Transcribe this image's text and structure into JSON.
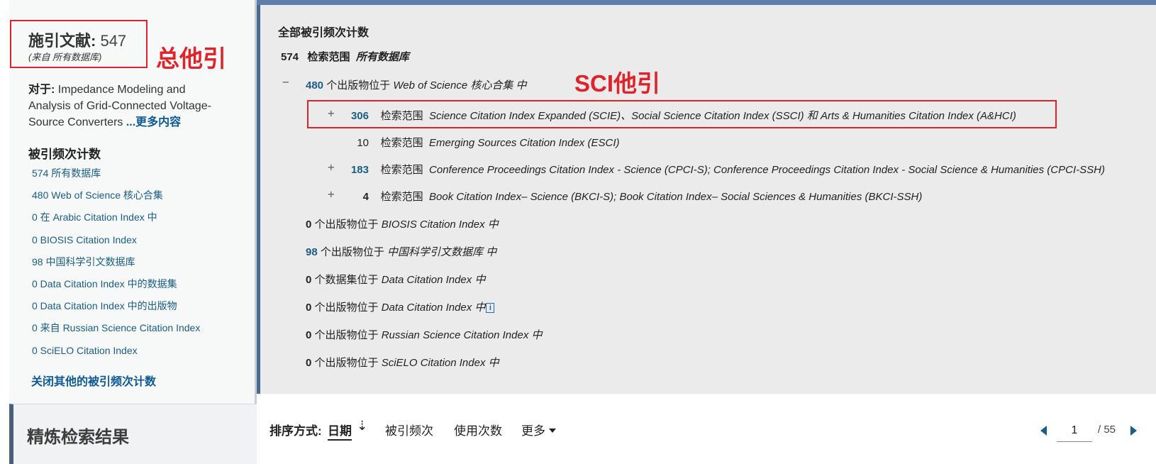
{
  "sidebar": {
    "citing_label": "施引文献:",
    "citing_count": "547",
    "citing_source": "(来自 所有数据库)",
    "for_label": "对于:",
    "for_title": "Impedance Modeling and Analysis of Grid-Connected Voltage-Source Converters",
    "for_more": "...更多内容",
    "counts_heading": "被引频次计数",
    "counts": [
      "574 所有数据库",
      "480 Web of Science 核心合集",
      "0 在 Arabic Citation Index 中",
      "0 BIOSIS Citation Index",
      "98 中国科学引文数据库",
      "0 Data Citation Index 中的数据集",
      "0 Data Citation Index 中的出版物",
      "0 来自 Russian Science Citation Index",
      "0 SciELO Citation Index"
    ],
    "close_link": "关闭其他的被引频次计数",
    "refine_title": "精炼检索结果"
  },
  "annotations": {
    "total": "总他引",
    "sci": "SCI他引"
  },
  "main": {
    "heading": "全部被引频次计数",
    "total_num": "574",
    "total_label": "检索范围",
    "total_scope": "所有数据库",
    "wos_num": "480",
    "wos_text": "个出版物位于",
    "wos_scope": "Web of Science 核心合集 中",
    "sub_rows": [
      {
        "num": "306",
        "label": "检索范围",
        "scope": "Science Citation Index Expanded (SCIE)、Social Science Citation Index (SSCI) 和 Arts & Humanities Citation Index (A&HCI)"
      },
      {
        "num": "10",
        "label": "检索范围",
        "scope": "Emerging Sources Citation Index (ESCI)"
      },
      {
        "num": "183",
        "label": "检索范围",
        "scope": "Conference Proceedings Citation Index - Science (CPCI-S);  Conference Proceedings Citation Index - Social Science & Humanities (CPCI-SSH)"
      },
      {
        "num": "4",
        "label": "检索范围",
        "scope": "Book Citation Index– Science (BKCI-S);  Book Citation Index– Social Sciences & Humanities (BKCI-SSH)"
      }
    ],
    "other_rows": [
      {
        "num": "0",
        "text": "个出版物位于",
        "scope": "BIOSIS Citation Index 中"
      },
      {
        "num": "98",
        "text": "个出版物位于",
        "scope": "中国科学引文数据库 中"
      },
      {
        "num": "0",
        "text": "个数据集位于",
        "scope": "Data Citation Index 中"
      },
      {
        "num": "0",
        "text": "个出版物位于",
        "scope": "Data Citation Index 中"
      },
      {
        "num": "0",
        "text": "个出版物位于",
        "scope": "Russian Science Citation Index 中"
      },
      {
        "num": "0",
        "text": "个出版物位于",
        "scope": "SciELO Citation Index 中"
      }
    ],
    "info_icon_glyph": "i"
  },
  "sort": {
    "label": "排序方式:",
    "date": "日期",
    "times_cited": "被引频次",
    "usage": "使用次数",
    "more": "更多"
  },
  "pager": {
    "current": "1",
    "total": "/ 55"
  },
  "icons": {
    "expand": "+",
    "collapse": "−",
    "sort": "⇣",
    "info": "info-icon"
  }
}
